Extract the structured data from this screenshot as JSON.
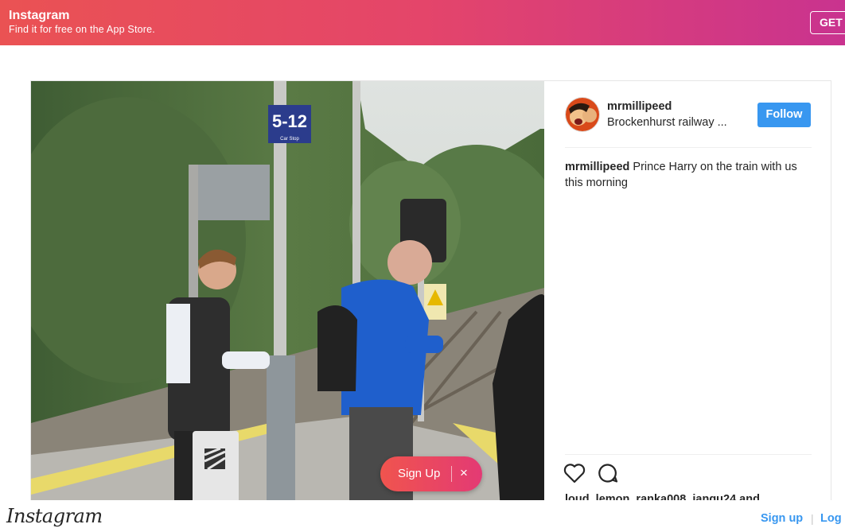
{
  "banner": {
    "app_name": "Instagram",
    "subtitle": "Find it for free on the App Store.",
    "get_label": "GET"
  },
  "post": {
    "username": "mrmillipeed",
    "location": "Brockenhurst railway ...",
    "follow_label": "Follow",
    "caption_user": "mrmillipeed",
    "caption_text": " Prince Harry on the train with us this morning",
    "likes_text": "loud_lemon, ranka008, jangu24 and",
    "photo_sign_text": "5-12",
    "photo_sign_sub": "Car Stop"
  },
  "overlay": {
    "signup_label": "Sign Up",
    "close_glyph": "×"
  },
  "footer": {
    "logo": "Instagram",
    "signup_label": "Sign up",
    "separator": "|",
    "login_label": "Log in"
  },
  "icons": {
    "like": "heart-icon",
    "comment": "comment-icon",
    "close": "close-icon"
  },
  "colors": {
    "brand_blue": "#3897f0",
    "banner_start": "#ea5253",
    "banner_end": "#c9338f"
  }
}
